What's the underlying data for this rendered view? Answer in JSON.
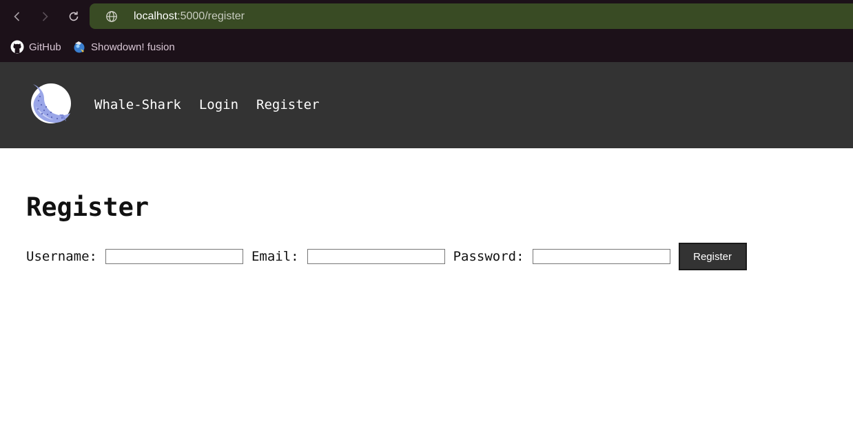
{
  "browser": {
    "url_host": "localhost",
    "url_path": ":5000/register",
    "bookmarks": [
      {
        "label": "GitHub",
        "icon": "github-icon"
      },
      {
        "label": "Showdown! fusion",
        "icon": "showdown-icon"
      }
    ]
  },
  "site": {
    "logo": "whale-shark-logo",
    "nav": [
      {
        "label": "Whale-Shark"
      },
      {
        "label": "Login"
      },
      {
        "label": "Register"
      }
    ]
  },
  "page": {
    "title": "Register",
    "form": {
      "username_label": "Username:",
      "username_value": "",
      "email_label": "Email:",
      "email_value": "",
      "password_label": "Password:",
      "password_value": "",
      "submit_label": "Register"
    }
  },
  "colors": {
    "chrome_bg": "#1c1119",
    "urlbar_bg": "#394b24",
    "header_bg": "#333333",
    "button_bg": "#333333"
  }
}
